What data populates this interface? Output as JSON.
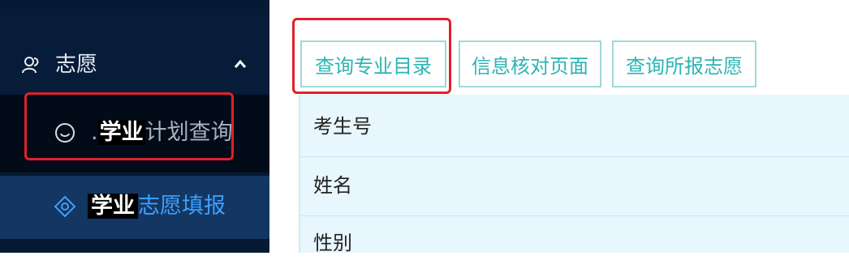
{
  "sidebar": {
    "group": {
      "label": "志愿",
      "icon": "user-group-icon",
      "chevron_icon": "chevron-up-icon"
    },
    "items": [
      {
        "icon": "smile-icon",
        "highlight": "学业",
        "label": "计划查询",
        "prefix": "."
      },
      {
        "icon": "eye-circle-icon",
        "highlight": "学业",
        "label": "志愿填报"
      }
    ]
  },
  "tabs": [
    {
      "label": "查询专业目录"
    },
    {
      "label": "信息核对页面"
    },
    {
      "label": "查询所报志愿"
    }
  ],
  "form": {
    "fields": [
      {
        "label": "考生号"
      },
      {
        "label": "姓名"
      },
      {
        "label": "性别"
      }
    ]
  },
  "colors": {
    "sidebar_bg": "#061a33",
    "active_item_bg": "#133662",
    "accent_teal": "#2bb5b3",
    "annotation_red": "#e0202a",
    "form_bg": "#e8f6fd"
  }
}
